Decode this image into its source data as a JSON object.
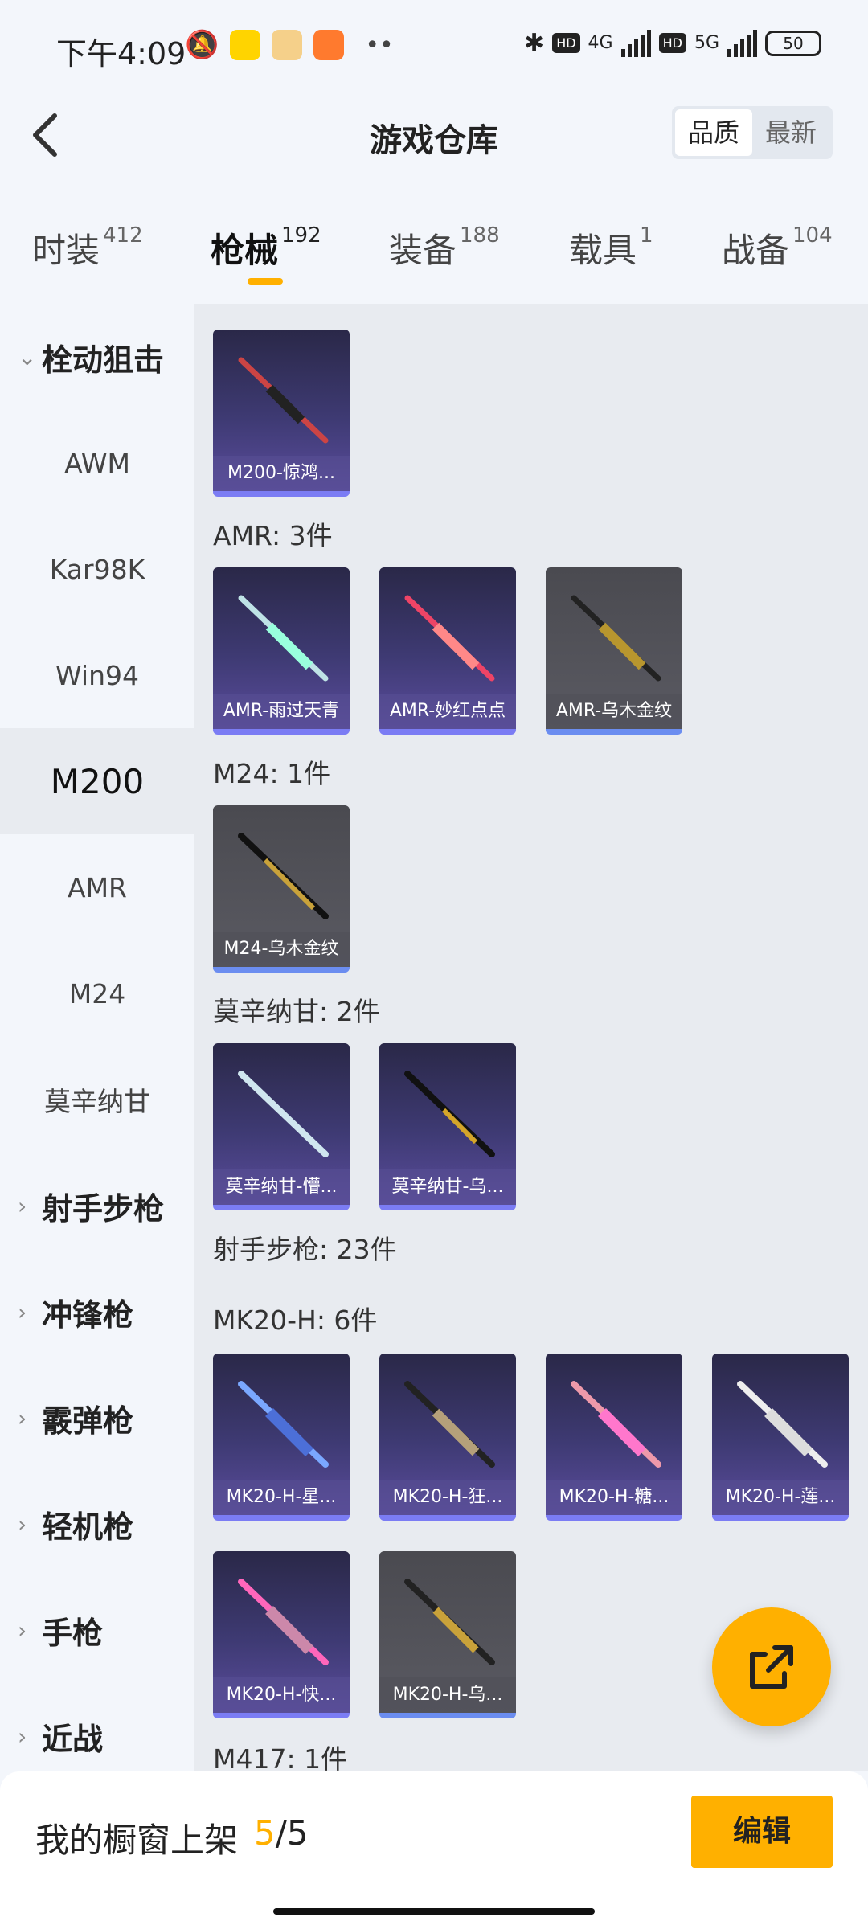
{
  "status_bar": {
    "time": "下午4:09",
    "network1": "4G",
    "network2": "5G",
    "hd": "HD",
    "battery": "50"
  },
  "header": {
    "title": "游戏仓库",
    "sort_quality": "品质",
    "sort_newest": "最新"
  },
  "tabs": [
    {
      "label": "时装",
      "count": "412"
    },
    {
      "label": "枪械",
      "count": "192"
    },
    {
      "label": "装备",
      "count": "188"
    },
    {
      "label": "载具",
      "count": "1"
    },
    {
      "label": "战备",
      "count": "104"
    }
  ],
  "sidebar": {
    "group_bolt": "栓动狙击",
    "items": [
      "AWM",
      "Kar98K",
      "Win94",
      "M200",
      "AMR",
      "M24",
      "莫辛纳甘"
    ],
    "groups": [
      "射手步枪",
      "冲锋枪",
      "霰弹枪",
      "轻机枪",
      "手枪",
      "近战"
    ]
  },
  "sections": {
    "amr": "AMR: 3件",
    "m24": "M24: 1件",
    "mosin": "莫辛纳甘: 2件",
    "dmr": "射手步枪: 23件",
    "mk20": "MK20-H: 6件",
    "m417": "M417: 1件"
  },
  "cards": {
    "m200_1": "M200-惊鸿...",
    "amr_1": "AMR-雨过天青",
    "amr_2": "AMR-妙红点点",
    "amr_3": "AMR-乌木金纹",
    "m24_1": "M24-乌木金纹",
    "mosin_1": "莫辛纳甘-懵...",
    "mosin_2": "莫辛纳甘-乌...",
    "mk20_1": "MK20-H-星...",
    "mk20_2": "MK20-H-狂...",
    "mk20_3": "MK20-H-糖...",
    "mk20_4": "MK20-H-莲...",
    "mk20_5": "MK20-H-快...",
    "mk20_6": "MK20-H-乌..."
  },
  "bottom": {
    "showcase_label": "我的橱窗上架",
    "current": "5",
    "total": "/5",
    "edit": "编辑"
  },
  "colors": {
    "accent": "#ffb000",
    "purple_card": "#3e3a73",
    "gray_card": "#55555c"
  }
}
